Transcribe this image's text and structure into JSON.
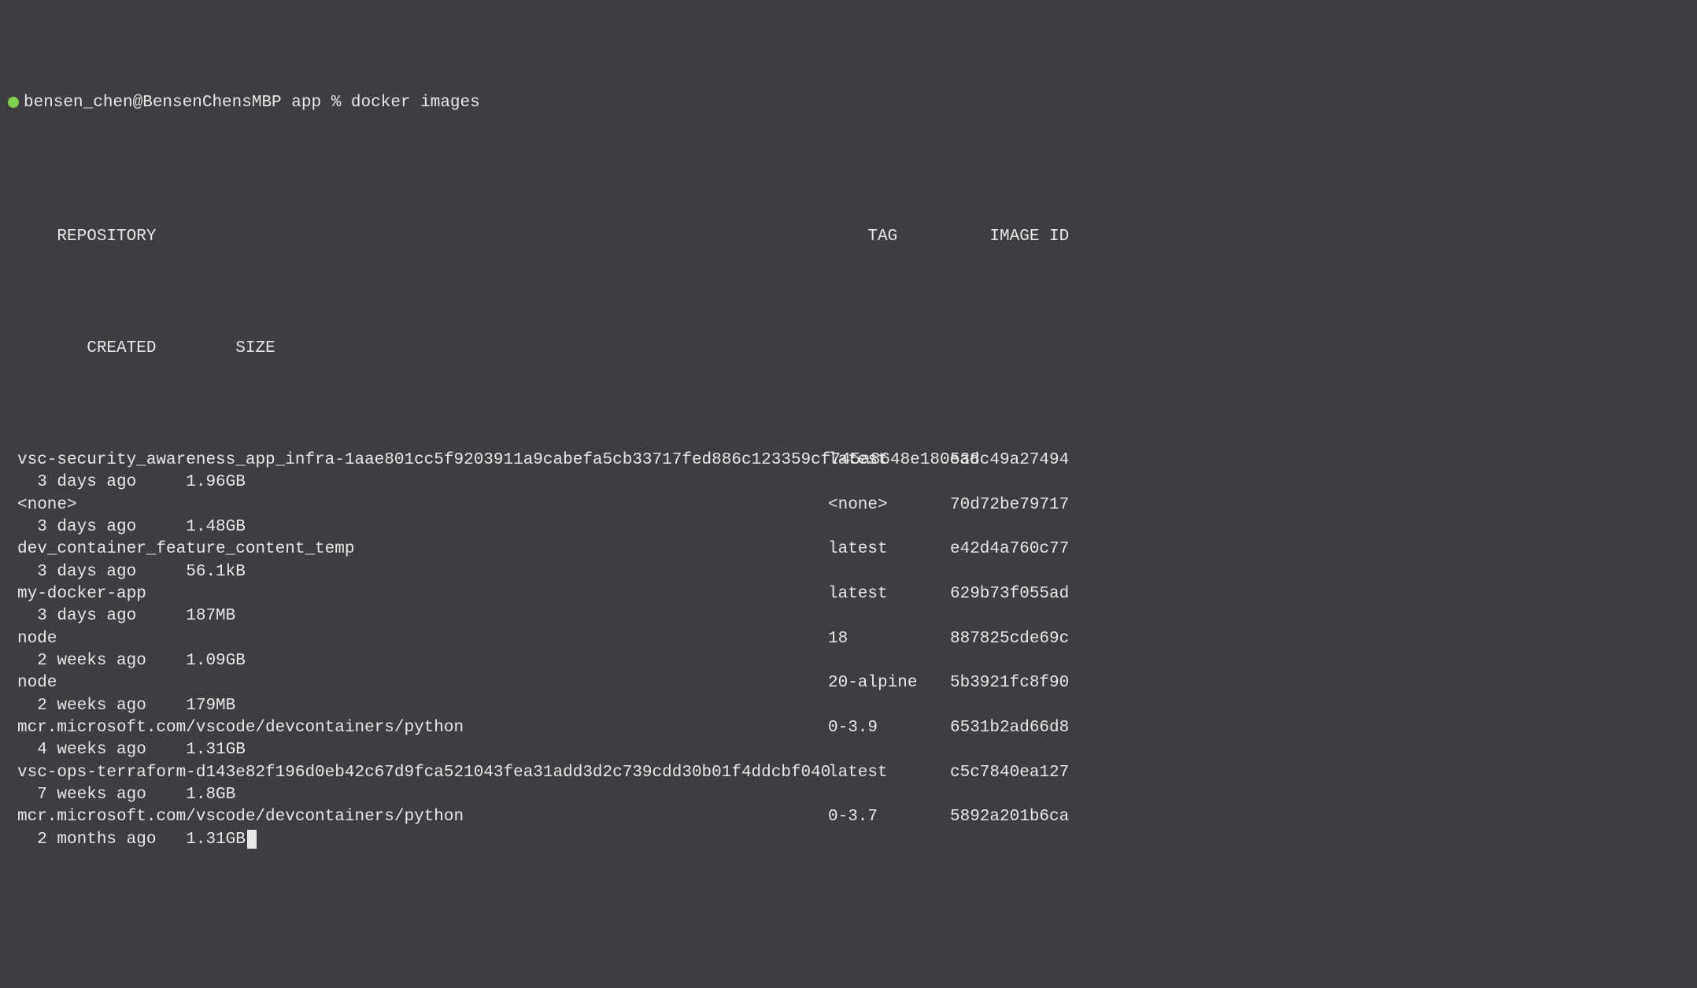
{
  "prompt": {
    "user_host": "bensen_chen@BensenChensMBP",
    "cwd": "app",
    "symbol": "%",
    "command": "docker images"
  },
  "header": {
    "repository": "REPOSITORY",
    "tag": "TAG",
    "image_id": "IMAGE ID",
    "created_indent": "   CREATED        SIZE"
  },
  "rows": [
    {
      "repository": "vsc-security_awareness_app_infra-1aae801cc5f9203911a9cabefa5cb33717fed886c123359cf745a8648e180ead",
      "tag": "latest",
      "image_id": "538c49a27494",
      "created_size": "  3 days ago     1.96GB"
    },
    {
      "repository": "<none>",
      "tag": "<none>",
      "image_id": "70d72be79717",
      "created_size": "  3 days ago     1.48GB"
    },
    {
      "repository": "dev_container_feature_content_temp",
      "tag": "latest",
      "image_id": "e42d4a760c77",
      "created_size": "  3 days ago     56.1kB"
    },
    {
      "repository": "my-docker-app",
      "tag": "latest",
      "image_id": "629b73f055ad",
      "created_size": "  3 days ago     187MB"
    },
    {
      "repository": "node",
      "tag": "18",
      "image_id": "887825cde69c",
      "created_size": "  2 weeks ago    1.09GB"
    },
    {
      "repository": "node",
      "tag": "20-alpine",
      "image_id": "5b3921fc8f90",
      "created_size": "  2 weeks ago    179MB"
    },
    {
      "repository": "mcr.microsoft.com/vscode/devcontainers/python",
      "tag": "0-3.9",
      "image_id": "6531b2ad66d8",
      "created_size": "  4 weeks ago    1.31GB"
    },
    {
      "repository": "vsc-ops-terraform-d143e82f196d0eb42c67d9fca521043fea31add3d2c739cdd30b01f4ddcbf040",
      "tag": "latest",
      "image_id": "c5c7840ea127",
      "created_size": "  7 weeks ago    1.8GB"
    },
    {
      "repository": "mcr.microsoft.com/vscode/devcontainers/python",
      "tag": "0-3.7",
      "image_id": "5892a201b6ca",
      "created_size": "  2 months ago   1.31GB"
    }
  ]
}
